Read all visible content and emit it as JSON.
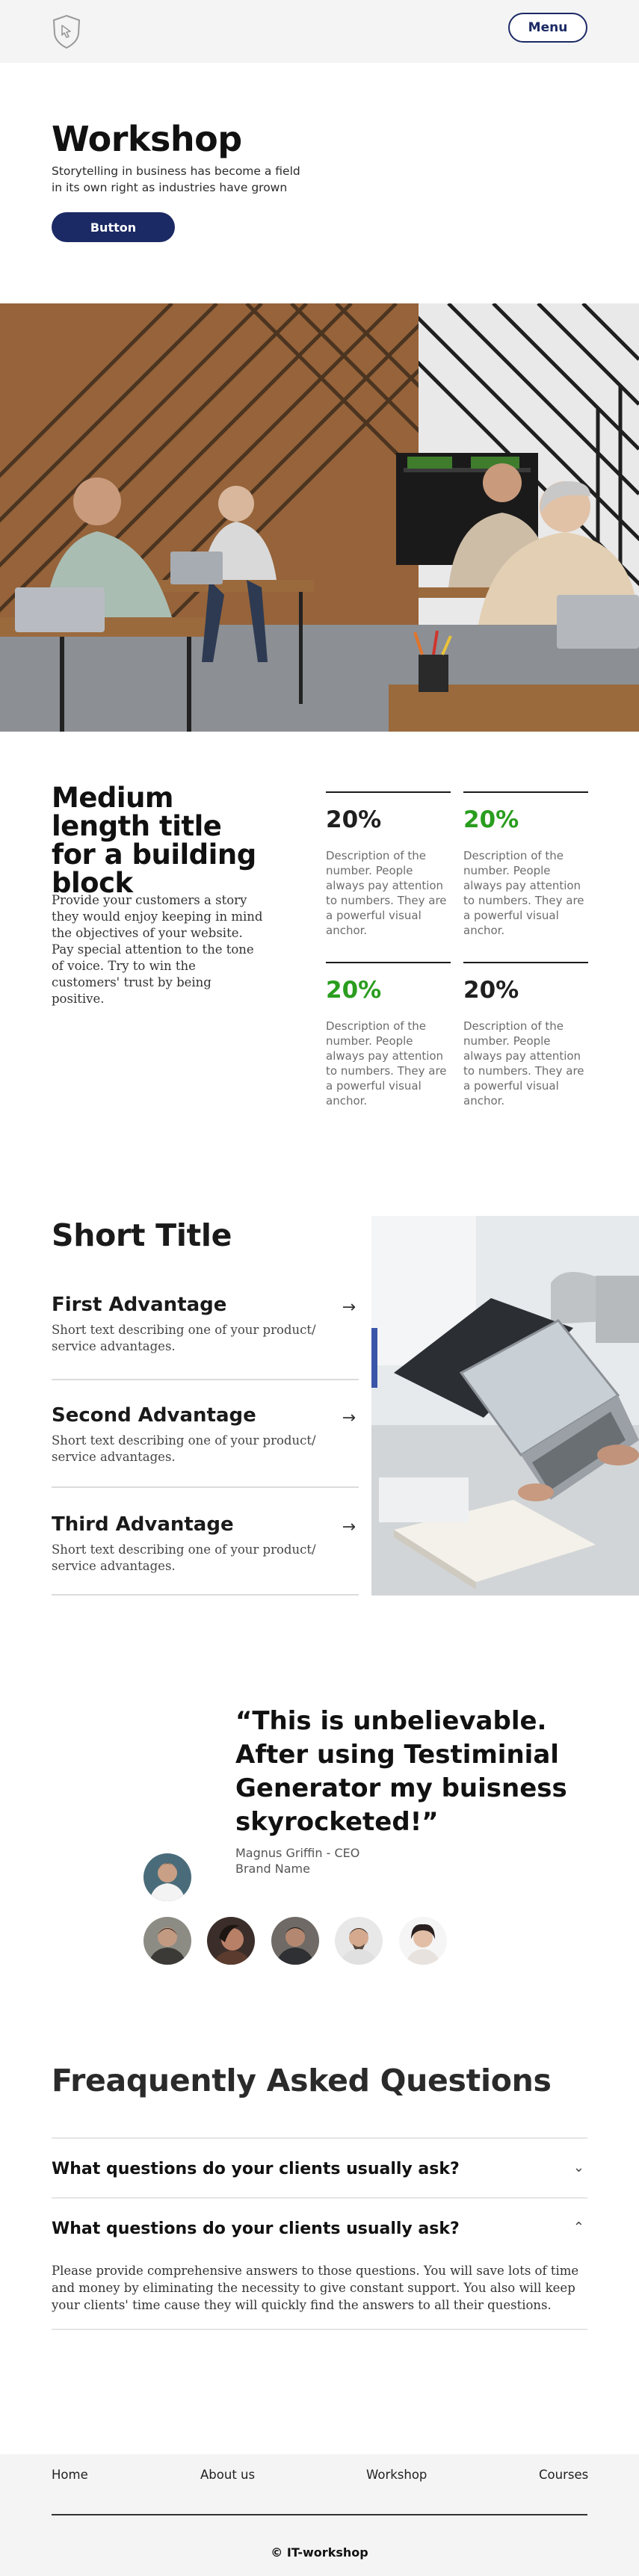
{
  "header": {
    "menu_label": "Menu",
    "logo_icon": "shield-cursor-icon"
  },
  "hero": {
    "title": "Workshop",
    "subtitle": "Storytelling in business has become a field in its own right as industries have grown",
    "button_label": "Button"
  },
  "stats_block": {
    "title": "Medium length title for a building block",
    "intro": "Provide your customers a story they would enjoy keeping in mind the objectives of your website. Pay special attention to the tone of voice. Try to win the customers' trust by being positive.",
    "items": [
      {
        "value": "20%",
        "color": "#111111",
        "description": "Description of the number. People always pay attention to numbers. They are a powerful visual anchor."
      },
      {
        "value": "20%",
        "color": "#2a9d1f",
        "description": "Description of the number. People always pay attention to numbers. They are a powerful visual anchor."
      },
      {
        "value": "20%",
        "color": "#2a9d1f",
        "description": "Description of the number. People always pay attention to numbers. They are a powerful visual anchor."
      },
      {
        "value": "20%",
        "color": "#111111",
        "description": "Description of the number. People always pay attention to numbers. They are a powerful visual anchor."
      }
    ]
  },
  "advantages": {
    "title": "Short Title",
    "items": [
      {
        "title": "First Advantage",
        "text": "Short text describing one of your product/ service advantages.",
        "icon": "arrow-right-icon"
      },
      {
        "title": "Second Advantage",
        "text": "Short text describing one of your product/ service advantages.",
        "icon": "arrow-right-icon"
      },
      {
        "title": "Third Advantage",
        "text": "Short text describing one of your product/ service advantages.",
        "icon": "arrow-right-icon"
      }
    ]
  },
  "testimonial": {
    "quote": "“This is unbelievable. After using Testiminial Generator my buisness skyrocketed!”",
    "author_line1": "Magnus Griffin - CEO",
    "author_line2": "Brand Name"
  },
  "faq": {
    "title": "Freaquently Asked Questions",
    "items": [
      {
        "question": "What questions do your clients usually ask?",
        "icon": "chevron-down-icon"
      },
      {
        "question": "What questions do your clients usually ask?",
        "icon": "chevron-up-icon",
        "answer": "Please provide comprehensive answers to those questions. You will save lots of time and money by eliminating the necessity to give constant support. You also will keep your clients' time cause they will quickly find the answers to all their questions."
      }
    ]
  },
  "footer": {
    "links": [
      "Home",
      "About us",
      "Workshop",
      "Courses"
    ],
    "copyright": "© IT-workshop"
  },
  "colors": {
    "brand_navy": "#1b2a64",
    "accent_green": "#2a9d1f",
    "light_bg": "#f4f4f4"
  }
}
